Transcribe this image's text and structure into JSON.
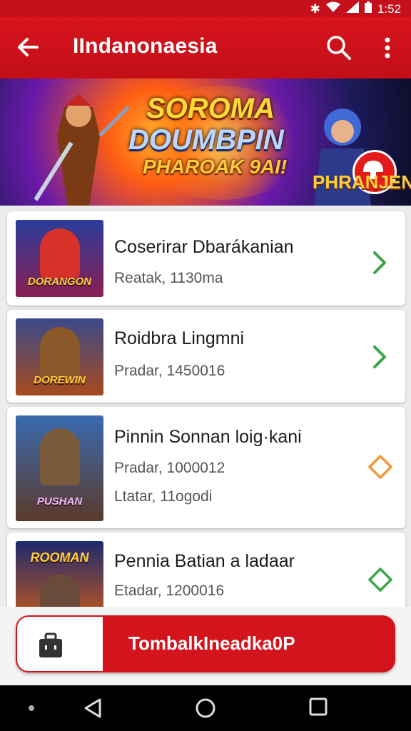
{
  "status_bar": {
    "time": "1:52",
    "icons": [
      "bluetooth-icon",
      "wifi-icon",
      "signal-icon",
      "battery-icon"
    ]
  },
  "app_bar": {
    "title": "IIndanonaesia",
    "icons": [
      "back-arrow-icon",
      "search-icon",
      "more-vert-icon"
    ]
  },
  "banner": {
    "line1": "SOROMA",
    "line2": "DOUMBPIN",
    "line3": "PHAROAK 9AI!",
    "logo": "PHRANJEN"
  },
  "games": [
    {
      "title": "Coserirar Dbarákanian",
      "lines": [
        "Reatak, 1130ma"
      ],
      "thumb_label": "DORANGON",
      "chevron_color": "#3aa548"
    },
    {
      "title": "Roidbra Lingmni",
      "lines": [
        "Pradar, 1450016"
      ],
      "thumb_label": "DOREWIN",
      "chevron_color": "#3aa548"
    },
    {
      "title": "Pinnin Sonnan loig·kani",
      "lines": [
        "Pradar, 1000012",
        "Ltatar, 11ogodi"
      ],
      "thumb_label": "PUSHAN",
      "chevron_color": "#f2963a"
    },
    {
      "title": "Pennia Batian a ladaar",
      "lines": [
        "Etadar, 1200016"
      ],
      "thumb_label": "ROOMAN",
      "chevron_color": "#3aa548"
    }
  ],
  "footer": {
    "cta_label": "TombalkIneadka0P",
    "cta_icon": "briefcase-icon"
  },
  "colors": {
    "primary_red": "#d4141c",
    "green": "#3aa548",
    "orange": "#f2963a"
  }
}
